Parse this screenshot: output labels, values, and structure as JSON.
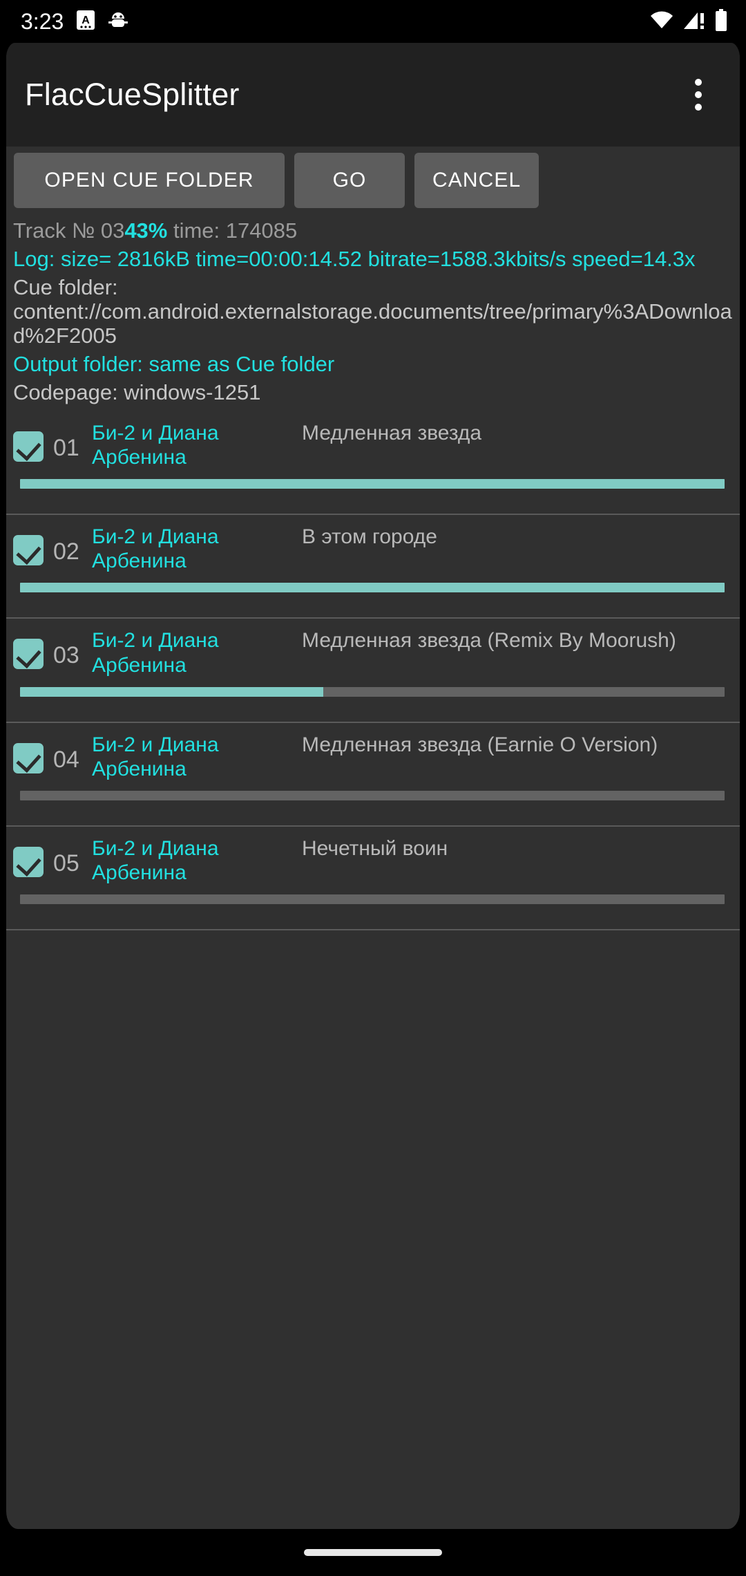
{
  "status_bar": {
    "clock": "3:23",
    "icons_left": [
      "alarm-a-icon",
      "android-debug-icon"
    ],
    "icons_right": [
      "wifi-icon",
      "cellular-signal-warning-icon",
      "battery-icon"
    ]
  },
  "app_bar": {
    "title": "FlacCueSplitter",
    "overflow_icon": "more-vert-icon"
  },
  "toolbar": {
    "open_cue_folder_label": "OPEN CUE FOLDER",
    "go_label": "GO",
    "cancel_label": "CANCEL"
  },
  "status": {
    "track_prefix": "Track № 03",
    "percent": "43%",
    "time_label": " time: 174085",
    "log": "Log: size=    2816kB time=00:00:14.52 bitrate=1588.3kbits/s speed=14.3x",
    "cue_folder": "Cue folder: content://com.android.externalstorage.documents/tree/primary%3ADownload%2F2005",
    "output_folder": "Output folder: same as Cue folder",
    "codepage": "Codepage: windows-1251"
  },
  "colors": {
    "accent_cyan": "#22e0e0",
    "progress_teal": "#80cbc4",
    "window_bg": "#303030",
    "appbar_bg": "#212121",
    "button_bg": "#5d5d5d"
  },
  "tracks": [
    {
      "checked": true,
      "number": "01",
      "artist": "Би-2 и Диана Арбенина",
      "title": "Медленная звезда",
      "progress": 100
    },
    {
      "checked": true,
      "number": "02",
      "artist": "Би-2 и Диана Арбенина",
      "title": "В этом городе",
      "progress": 100
    },
    {
      "checked": true,
      "number": "03",
      "artist": "Би-2 и Диана Арбенина",
      "title": "Медленная звезда (Remix By Moorush)",
      "progress": 43
    },
    {
      "checked": true,
      "number": "04",
      "artist": "Би-2 и Диана Арбенина",
      "title": "Медленная звезда (Earnie O Version)",
      "progress": 0
    },
    {
      "checked": true,
      "number": "05",
      "artist": "Би-2 и Диана Арбенина",
      "title": "Нечетный воин",
      "progress": 0
    }
  ],
  "nav_bar": {
    "gesture_pill": "home-gesture-pill"
  }
}
